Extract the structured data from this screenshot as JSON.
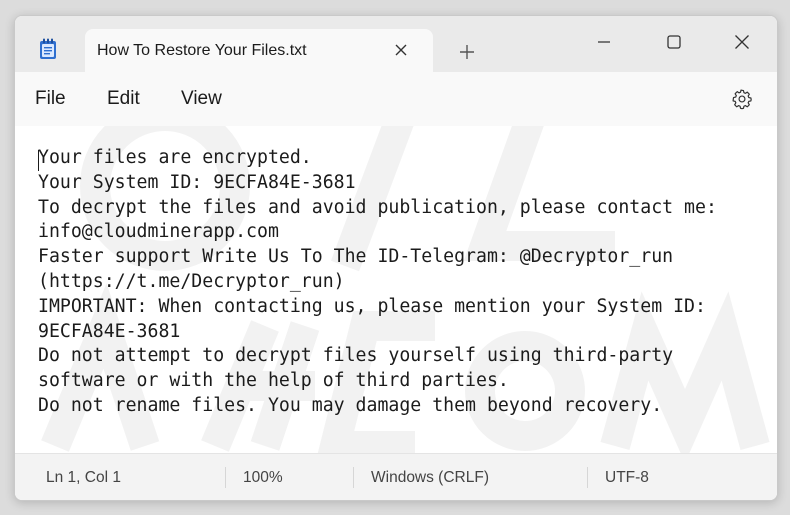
{
  "tab": {
    "title": "How To Restore Your Files.txt"
  },
  "menu": [
    "File",
    "Edit",
    "View"
  ],
  "icons": {
    "app": "notepad-icon",
    "tab_close": "close-icon",
    "new_tab": "plus-icon",
    "minimize": "minimize-icon",
    "maximize": "maximize-icon",
    "close": "close-icon",
    "settings": "gear-icon"
  },
  "document": {
    "lines": [
      "Your files are encrypted.",
      "Your System ID: 9ECFA84E-3681",
      "To decrypt the files and avoid publication, please contact me:",
      "info@cloudminerapp.com",
      "Faster support Write Us To The ID-Telegram: @Decryptor_run",
      "(https://t.me/Decryptor_run)",
      "IMPORTANT: When contacting us, please mention your System ID:",
      "9ECFA84E-3681",
      "Do not attempt to decrypt files yourself using third-party",
      "software or with the help of third parties.",
      "Do not rename files. You may damage them beyond recovery."
    ]
  },
  "status": {
    "position": "Ln 1, Col 1",
    "zoom": "100%",
    "line_ending": "Windows (CRLF)",
    "encoding": "UTF-8"
  },
  "colors": {
    "titlebar": "#eaeaea",
    "tab": "#f9f9f9",
    "editor_bg": "#ffffff",
    "text": "#1b1b1b"
  }
}
